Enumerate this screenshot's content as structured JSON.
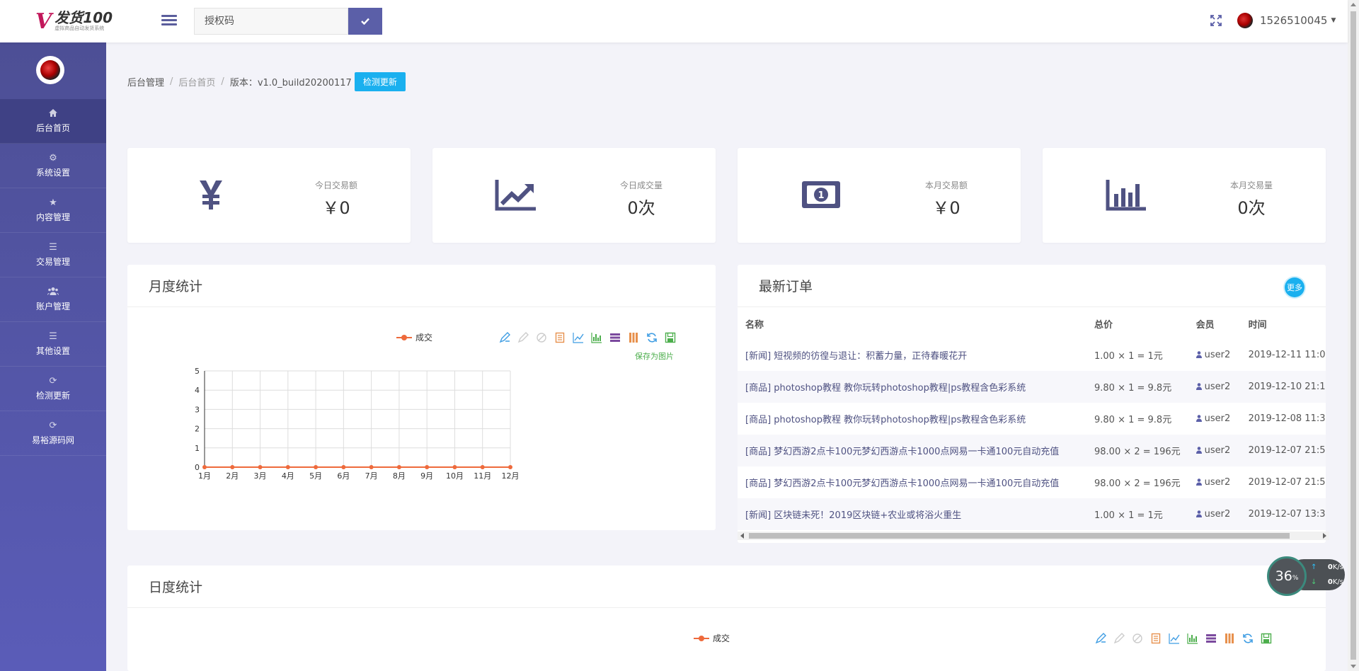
{
  "header": {
    "logo_name": "发货100",
    "logo_sub": "虚拟商品自动发货系统",
    "auth_placeholder": "授权码",
    "username": "1526510045"
  },
  "sidebar": {
    "items": [
      {
        "label": "后台首页",
        "icon": "home-icon"
      },
      {
        "label": "系统设置",
        "icon": "gear-icon"
      },
      {
        "label": "内容管理",
        "icon": "star-icon"
      },
      {
        "label": "交易管理",
        "icon": "list-icon"
      },
      {
        "label": "账户管理",
        "icon": "users-icon"
      },
      {
        "label": "其他设置",
        "icon": "list-icon"
      },
      {
        "label": "检测更新",
        "icon": "refresh-icon"
      },
      {
        "label": "易裕源码网",
        "icon": "refresh-icon"
      }
    ]
  },
  "breadcrumb": {
    "root": "后台管理",
    "current": "后台首页",
    "version": "版本：v1.0_build20200117",
    "check_button": "检测更新"
  },
  "stats": [
    {
      "label": "今日交易额",
      "value": "￥0",
      "icon": "yen-icon"
    },
    {
      "label": "今日成交量",
      "value": "0次",
      "icon": "line-chart-icon"
    },
    {
      "label": "本月交易额",
      "value": "￥0",
      "icon": "money-icon"
    },
    {
      "label": "本月交易量",
      "value": "0次",
      "icon": "bar-chart-icon"
    }
  ],
  "monthly": {
    "title": "月度统计",
    "save_hint": "保存为图片"
  },
  "chart_data": {
    "type": "line",
    "categories": [
      "1月",
      "2月",
      "3月",
      "4月",
      "5月",
      "6月",
      "7月",
      "8月",
      "9月",
      "10月",
      "11月",
      "12月"
    ],
    "series": [
      {
        "name": "成交",
        "values": [
          0,
          0,
          0,
          0,
          0,
          0,
          0,
          0,
          0,
          0,
          0,
          0
        ]
      }
    ],
    "y_ticks": [
      "0",
      "1",
      "2",
      "3",
      "4",
      "5"
    ],
    "ylim": [
      0,
      5
    ],
    "grid": true,
    "legend_position": "top-center",
    "line_color": "#ee6a3c"
  },
  "orders": {
    "title": "最新订单",
    "more": "更多",
    "columns": [
      "名称",
      "总价",
      "会员",
      "时间"
    ],
    "rows": [
      {
        "name": "[新闻] 短视频的彷徨与退让：积蓄力量，正待春暖花开",
        "price": "1.00 × 1 = 1元",
        "user": "user2",
        "time": "2019-12-11 11:0"
      },
      {
        "name": "[商品] photoshop教程 教你玩转photoshop教程|ps教程含色彩系统",
        "price": "9.80 × 1 = 9.8元",
        "user": "user2",
        "time": "2019-12-10 21:1"
      },
      {
        "name": "[商品] photoshop教程 教你玩转photoshop教程|ps教程含色彩系统",
        "price": "9.80 × 1 = 9.8元",
        "user": "user2",
        "time": "2019-12-08 11:3"
      },
      {
        "name": "[商品] 梦幻西游2点卡100元梦幻西游点卡1000点网易一卡通100元自动充值",
        "price": "98.00 × 2 = 196元",
        "user": "user2",
        "time": "2019-12-07 21:5"
      },
      {
        "name": "[商品] 梦幻西游2点卡100元梦幻西游点卡1000点网易一卡通100元自动充值",
        "price": "98.00 × 2 = 196元",
        "user": "user2",
        "time": "2019-12-07 21:5"
      },
      {
        "name": "[新闻] 区块链未死！2019区块链+农业或将浴火重生",
        "price": "1.00 × 1 = 1元",
        "user": "user2",
        "time": "2019-12-07 13:3"
      }
    ]
  },
  "daily": {
    "title": "日度统计",
    "legend": "成交"
  },
  "speed_widget": {
    "percent": "36",
    "percent_unit": "%",
    "up": "0",
    "down": "0",
    "unit": "K/s"
  }
}
